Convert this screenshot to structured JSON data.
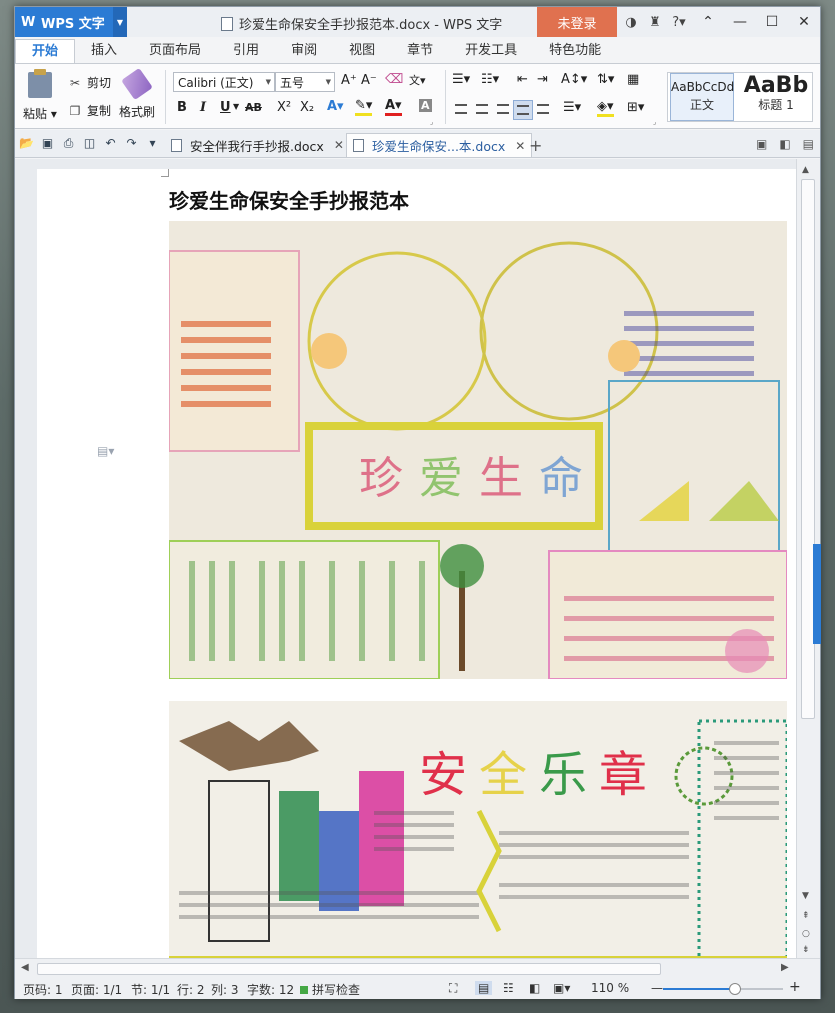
{
  "app": {
    "menu_label": "WPS 文字",
    "window_title": "珍爱生命保安全手抄报范本.docx - WPS 文字",
    "login_label": "未登录"
  },
  "ribbon": {
    "tabs": [
      "开始",
      "插入",
      "页面布局",
      "引用",
      "审阅",
      "视图",
      "章节",
      "开发工具",
      "特色功能"
    ],
    "paste_label": "粘贴",
    "cut_label": "剪切",
    "copy_label": "复制",
    "format_painter_label": "格式刷",
    "font_name": "Calibri (正文)",
    "font_size": "五号",
    "bold": "B",
    "italic": "I",
    "underline": "U",
    "strike": "AB",
    "superscript": "X²",
    "subscript": "X₂",
    "styles": [
      {
        "sample": "AaBbCcDd",
        "name": "正文"
      },
      {
        "sample": "AaBb",
        "name": "标题 1"
      }
    ]
  },
  "document_tabs": [
    {
      "label": "安全伴我行手抄报.docx",
      "active": false
    },
    {
      "label": "珍爱生命保安...本.docx",
      "active": true
    }
  ],
  "document": {
    "title": "珍爱生命保安全手抄报范本"
  },
  "statusbar": {
    "page_num": "页码: 1",
    "pages": "页面: 1/1",
    "section": "节: 1/1",
    "row": "行: 2",
    "col": "列: 3",
    "word_count": "字数: 12",
    "spell_check": "拼写检查",
    "zoom": "110 %",
    "zoom_level_percent": 60
  },
  "colors": {
    "accent": "#2b7bd4",
    "login": "#e0714f"
  }
}
